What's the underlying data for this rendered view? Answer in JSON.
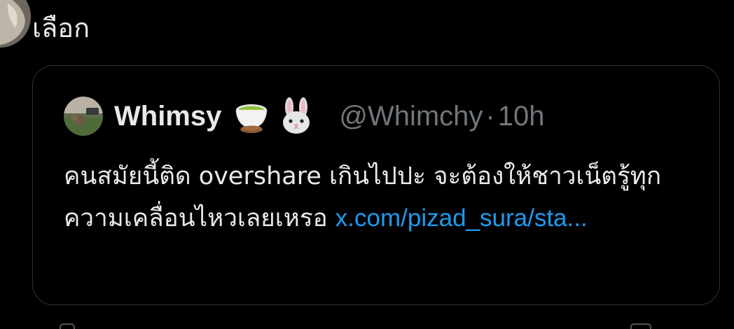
{
  "reply": {
    "text": "เลือก"
  },
  "quote": {
    "display_name": "Whimsy",
    "emojis": [
      "tea-cup-icon",
      "rabbit-icon"
    ],
    "handle": "@Whimchy",
    "separator": "·",
    "time": "10h",
    "body_text": "คนสมัยนี้ติด overshare เกินไปปะ จะต้องให้ชาวเน็ตรู้ทุกความเคลื่อนไหวเลยเหรอ ",
    "link_text": "x.com/pizad_sura/sta..."
  },
  "colors": {
    "background": "#000000",
    "text_primary": "#e7e9ea",
    "text_secondary": "#71767b",
    "link": "#1d9bf0",
    "border": "#2f3336"
  }
}
